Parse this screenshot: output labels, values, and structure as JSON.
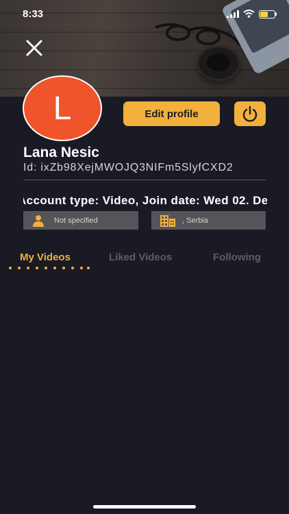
{
  "status_bar": {
    "time": "8:33",
    "battery_level": 0.55
  },
  "profile": {
    "avatar_letter": "L",
    "name": "Lana Nesic",
    "id_text": "Id: ixZb98XejMWOJQ3NIFm5SlyfCXD2",
    "account_text": "Account type: Video, Join date: Wed 02. De",
    "gender": "Not specified",
    "location": ", Serbia"
  },
  "buttons": {
    "edit_profile": "Edit profile"
  },
  "tabs": [
    {
      "label": "My Videos",
      "active": true
    },
    {
      "label": "Liked Videos",
      "active": false
    },
    {
      "label": "Following",
      "active": false
    }
  ],
  "colors": {
    "accent": "#f2b03c",
    "avatar": "#f0542b",
    "background": "#1a1a24",
    "info_box": "#555559"
  },
  "icons": [
    "close-icon",
    "power-icon",
    "person-icon",
    "building-icon",
    "signal-icon",
    "wifi-icon",
    "battery-icon"
  ]
}
